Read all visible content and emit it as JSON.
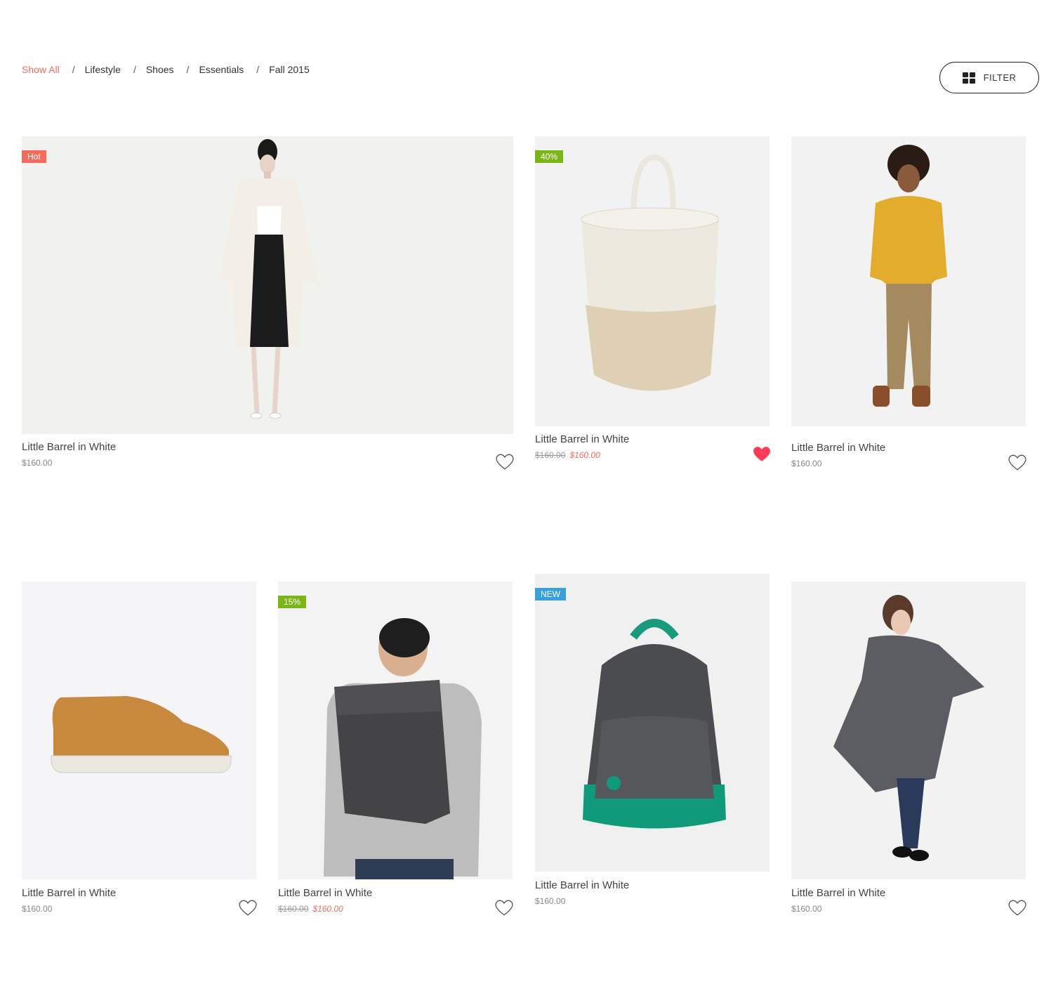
{
  "breadcrumb": {
    "items": [
      {
        "label": "Show All",
        "active": true
      },
      {
        "label": "Lifestyle"
      },
      {
        "label": "Shoes"
      },
      {
        "label": "Essentials"
      },
      {
        "label": "Fall 2015"
      }
    ],
    "separator": "/"
  },
  "filter": {
    "label": "FILTER",
    "icon": "grid-icon"
  },
  "colors": {
    "accent": "#f26c5a",
    "badge_hot": "#f56a5c",
    "badge_sale": "#7cb518",
    "badge_new": "#3aa0dc",
    "heart_active": "#ff3b57"
  },
  "products": [
    {
      "title": "Little Barrel in White",
      "price": "$160.00",
      "badge": "Hot",
      "liked": false
    },
    {
      "title": "Little Barrel in White",
      "old_price": "$160.00",
      "new_price": "$160.00",
      "badge": "40%",
      "liked": true
    },
    {
      "title": "Little Barrel in White",
      "price": "$160.00",
      "liked": false
    },
    {
      "title": "Little Barrel in White",
      "price": "$160.00",
      "liked": false
    },
    {
      "title": "Little Barrel in White",
      "old_price": "$160.00",
      "new_price": "$160.00",
      "badge": "15%",
      "liked": false
    },
    {
      "title": "Little Barrel in White",
      "price": "$160.00",
      "badge": "NEW"
    },
    {
      "title": "Little Barrel in White",
      "price": "$160.00",
      "liked": false
    }
  ]
}
